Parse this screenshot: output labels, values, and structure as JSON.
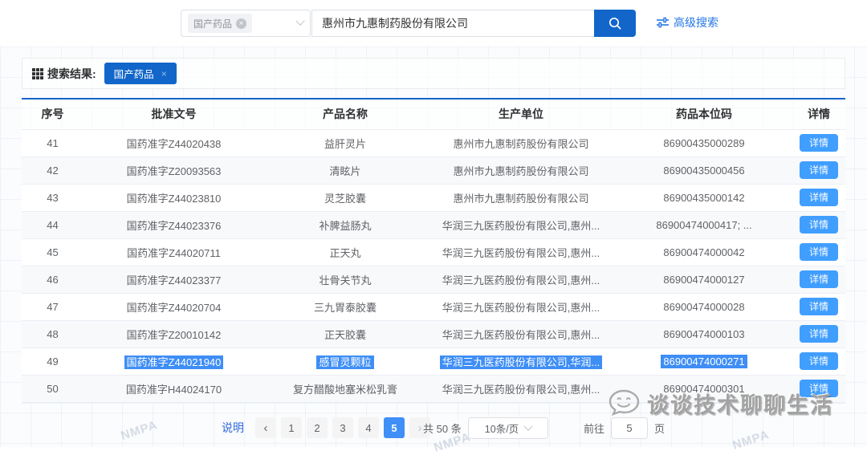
{
  "colors": {
    "brand_blue": "#1266c9",
    "primary_blue": "#409eff",
    "selection_blue": "#3e8ef6",
    "link_blue": "#2477e3"
  },
  "search_bar": {
    "category_tag_label": "国产药品",
    "query_value": "惠州市九惠制药股份有限公司",
    "advanced_search_label": "高级搜索"
  },
  "results_header": {
    "label": "搜索结果:",
    "filter_tag_label": "国产药品",
    "filter_tag_close": "×"
  },
  "table": {
    "columns": [
      "序号",
      "批准文号",
      "产品名称",
      "生产单位",
      "药品本位码",
      "详情"
    ],
    "detail_button_label": "详情",
    "rows": [
      {
        "no": "41",
        "approval": "国药准字Z44020438",
        "product": "益肝灵片",
        "manufacturer": "惠州市九惠制药股份有限公司",
        "code": "86900435000289",
        "highlighted": false
      },
      {
        "no": "42",
        "approval": "国药准字Z20093563",
        "product": "清眩片",
        "manufacturer": "惠州市九惠制药股份有限公司",
        "code": "86900435000456",
        "highlighted": false
      },
      {
        "no": "43",
        "approval": "国药准字Z44023810",
        "product": "灵芝胶囊",
        "manufacturer": "惠州市九惠制药股份有限公司",
        "code": "86900435000142",
        "highlighted": false
      },
      {
        "no": "44",
        "approval": "国药准字Z44023376",
        "product": "补脾益肠丸",
        "manufacturer": "华润三九医药股份有限公司,惠州...",
        "code": "86900474000417;  ...",
        "highlighted": false
      },
      {
        "no": "45",
        "approval": "国药准字Z44020711",
        "product": "正天丸",
        "manufacturer": "华润三九医药股份有限公司,惠州...",
        "code": "86900474000042",
        "highlighted": false
      },
      {
        "no": "46",
        "approval": "国药准字Z44023377",
        "product": "壮骨关节丸",
        "manufacturer": "华润三九医药股份有限公司,惠州...",
        "code": "86900474000127",
        "highlighted": false
      },
      {
        "no": "47",
        "approval": "国药准字Z44020704",
        "product": "三九胃泰胶囊",
        "manufacturer": "华润三九医药股份有限公司,惠州...",
        "code": "86900474000028",
        "highlighted": false
      },
      {
        "no": "48",
        "approval": "国药准字Z20010142",
        "product": "正天胶囊",
        "manufacturer": "华润三九医药股份有限公司,惠州...",
        "code": "86900474000103",
        "highlighted": false
      },
      {
        "no": "49",
        "approval": "国药准字Z44021940",
        "product": "感冒灵颗粒",
        "manufacturer": "华润三九医药股份有限公司,华润...",
        "code": "86900474000271",
        "highlighted": true
      },
      {
        "no": "50",
        "approval": "国药准字H44024170",
        "product": "复方醋酸地塞米松乳膏",
        "manufacturer": "华润三九医药股份有限公司,惠州...",
        "code": "86900474000301",
        "highlighted": false
      }
    ]
  },
  "pagination": {
    "note_label": "说明",
    "prev": "‹",
    "next": "›",
    "pages": [
      "1",
      "2",
      "3",
      "4",
      "5"
    ],
    "active_page": "5",
    "total_label": "共 50 条",
    "page_size_label": "10条/页",
    "goto_label": "前往",
    "goto_value": "5",
    "goto_suffix": "页"
  },
  "watermark": {
    "text": "谈谈技术聊聊生活",
    "background_marks": [
      "NMPA",
      "NMPA",
      "NMPA"
    ]
  }
}
